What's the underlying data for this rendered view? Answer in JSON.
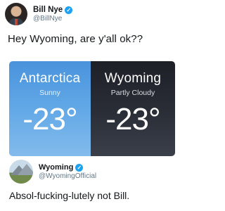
{
  "tweet": {
    "author": {
      "name": "Bill Nye",
      "handle": "@BillNye",
      "avatar": "bill-nye-avatar",
      "verified_icon": "verified-badge-icon"
    },
    "text": "Hey Wyoming, are y'all ok??",
    "image": {
      "left": {
        "city": "Antarctica",
        "condition": "Sunny",
        "temp": "-23°",
        "color": "#5fa6e6"
      },
      "right": {
        "city": "Wyoming",
        "condition": "Partly Cloudy",
        "temp": "-23°",
        "color": "#2a2e37"
      }
    }
  },
  "reply": {
    "author": {
      "name": "Wyoming",
      "handle": "@WyomingOfficial",
      "avatar": "wyoming-mountain-avatar",
      "verified_icon": "verified-badge-icon"
    },
    "text": "Absol-fucking-lutely not Bill."
  },
  "colors": {
    "verified": "#1da1f2",
    "handle": "#657786"
  }
}
